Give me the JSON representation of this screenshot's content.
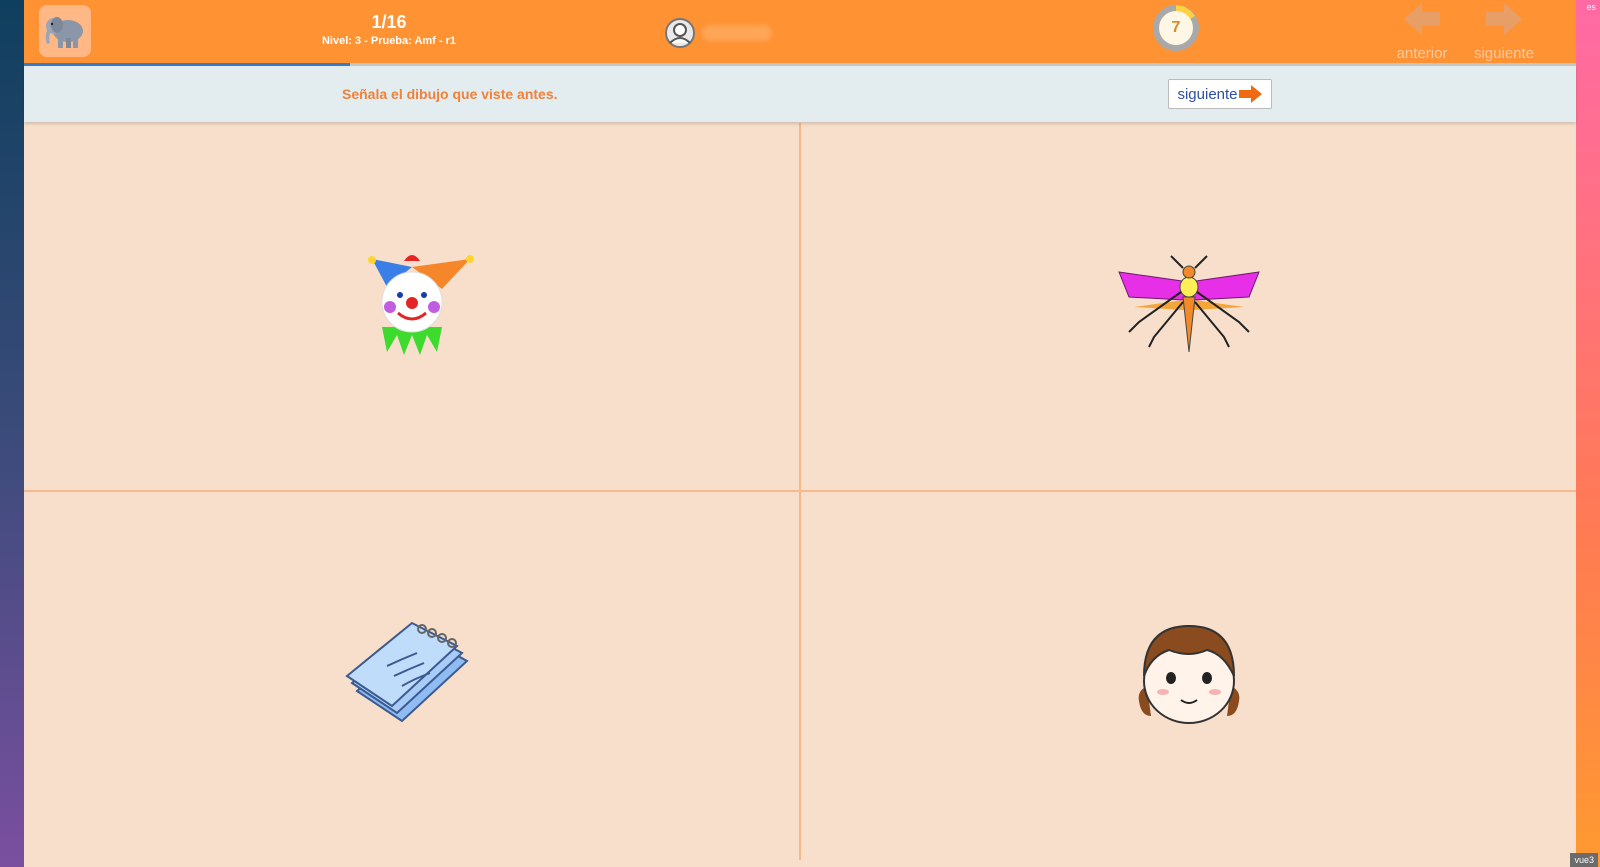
{
  "header": {
    "counter": "1/16",
    "level_line": "Nivel: 3 - Prueba: Amf - r1",
    "progress_fraction": 0.21,
    "timer_value": "7",
    "prev_label": "anterior",
    "next_label": "siguiente",
    "logo_icon": "elephant-icon",
    "user_icon": "user-avatar-icon"
  },
  "instruction_bar": {
    "instruction": "Señala el dibujo que viste antes.",
    "next_button_label": "siguiente"
  },
  "options": [
    {
      "name": "clown",
      "icon": "clown-icon"
    },
    {
      "name": "insect",
      "icon": "insect-icon"
    },
    {
      "name": "notepad",
      "icon": "notepad-icon"
    },
    {
      "name": "girl-face",
      "icon": "girl-face-icon"
    }
  ],
  "corner_tags": {
    "top": "es",
    "bottom": "vue3"
  },
  "colors": {
    "header": "#ff9232",
    "instruction_text": "#f0813a",
    "content_bg": "#f8dfcb",
    "progress": "#3b7bbf"
  }
}
